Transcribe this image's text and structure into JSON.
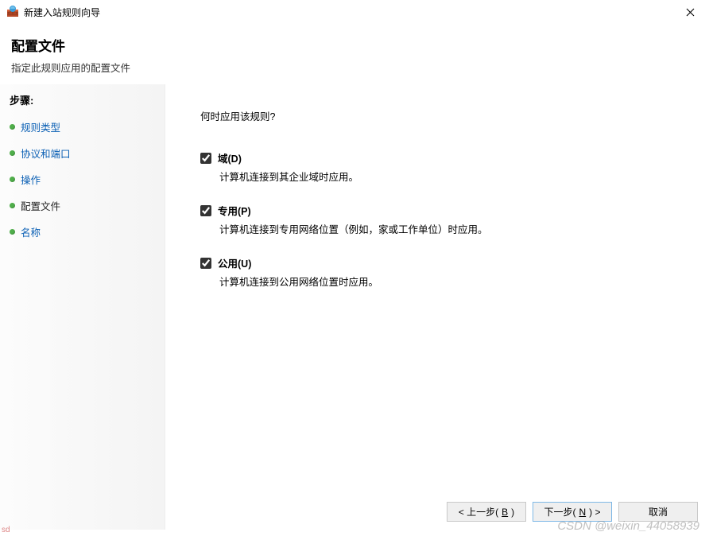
{
  "window": {
    "title": "新建入站规则向导"
  },
  "header": {
    "title": "配置文件",
    "subtitle": "指定此规则应用的配置文件"
  },
  "sidebar": {
    "heading": "步骤:",
    "items": [
      {
        "label": "规则类型",
        "active": false
      },
      {
        "label": "协议和端口",
        "active": false
      },
      {
        "label": "操作",
        "active": false
      },
      {
        "label": "配置文件",
        "active": true
      },
      {
        "label": "名称",
        "active": false
      }
    ]
  },
  "main": {
    "question": "何时应用该规则?",
    "options": [
      {
        "label": "域(D)",
        "desc": "计算机连接到其企业域时应用。",
        "checked": true
      },
      {
        "label": "专用(P)",
        "desc": "计算机连接到专用网络位置（例如，家或工作单位）时应用。",
        "checked": true
      },
      {
        "label": "公用(U)",
        "desc": "计算机连接到公用网络位置时应用。",
        "checked": true
      }
    ]
  },
  "buttons": {
    "back_prefix": "< 上一步(",
    "back_hot": "B",
    "back_suffix": ")",
    "next_prefix": "下一步(",
    "next_hot": "N",
    "next_suffix": ") >",
    "cancel": "取消"
  },
  "watermark": {
    "sd": "sd",
    "csdn": "CSDN @weixin_44058939"
  }
}
